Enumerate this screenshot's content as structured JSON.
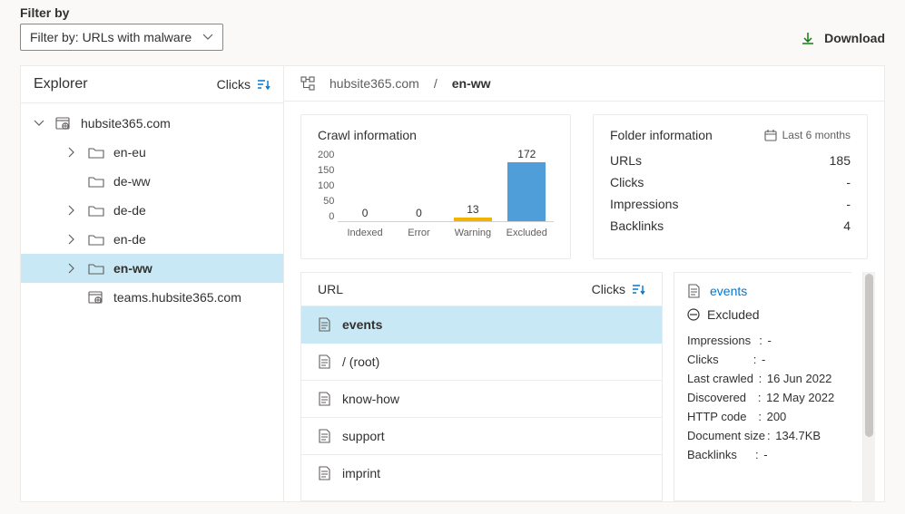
{
  "filter": {
    "label": "Filter by",
    "selected": "Filter by: URLs with malware"
  },
  "download": {
    "label": "Download"
  },
  "explorer": {
    "title": "Explorer",
    "sort": "Clicks",
    "tree": [
      {
        "label": "hubsite365.com"
      },
      {
        "label": "en-eu"
      },
      {
        "label": "de-ww"
      },
      {
        "label": "de-de"
      },
      {
        "label": "en-de"
      },
      {
        "label": "en-ww"
      },
      {
        "label": "teams.hubsite365.com"
      }
    ]
  },
  "breadcrumb": {
    "root": "hubsite365.com",
    "leaf": "en-ww"
  },
  "crawl": {
    "title": "Crawl information",
    "y_ticks": [
      "200",
      "150",
      "100",
      "50",
      "0"
    ],
    "bars": [
      {
        "label": "Indexed",
        "value": "0"
      },
      {
        "label": "Error",
        "value": "0"
      },
      {
        "label": "Warning",
        "value": "13"
      },
      {
        "label": "Excluded",
        "value": "172"
      }
    ]
  },
  "folder": {
    "title": "Folder information",
    "period": "Last 6 months",
    "rows": [
      {
        "k": "URLs",
        "v": "185"
      },
      {
        "k": "Clicks",
        "v": "-"
      },
      {
        "k": "Impressions",
        "v": "-"
      },
      {
        "k": "Backlinks",
        "v": "4"
      }
    ]
  },
  "url_list": {
    "header": "URL",
    "sort": "Clicks",
    "items": [
      {
        "label": "events"
      },
      {
        "label": "/ (root)"
      },
      {
        "label": "know-how"
      },
      {
        "label": "support"
      },
      {
        "label": "imprint"
      }
    ]
  },
  "url_detail": {
    "name": "events",
    "status": "Excluded",
    "kv": [
      {
        "k": "Impressions",
        "v": "-"
      },
      {
        "k": "Clicks",
        "v": "-"
      },
      {
        "k": "Last crawled",
        "v": "16 Jun 2022"
      },
      {
        "k": "Discovered",
        "v": "12 May 2022"
      },
      {
        "k": "HTTP code",
        "v": "200"
      },
      {
        "k": "Document size",
        "v": "134.7KB"
      },
      {
        "k": "Backlinks",
        "v": "-"
      }
    ]
  },
  "chart_data": {
    "type": "bar",
    "title": "Crawl information",
    "categories": [
      "Indexed",
      "Error",
      "Warning",
      "Excluded"
    ],
    "values": [
      0,
      0,
      13,
      172
    ],
    "ylim": [
      0,
      200
    ],
    "y_ticks": [
      0,
      50,
      100,
      150,
      200
    ],
    "xlabel": "",
    "ylabel": ""
  }
}
